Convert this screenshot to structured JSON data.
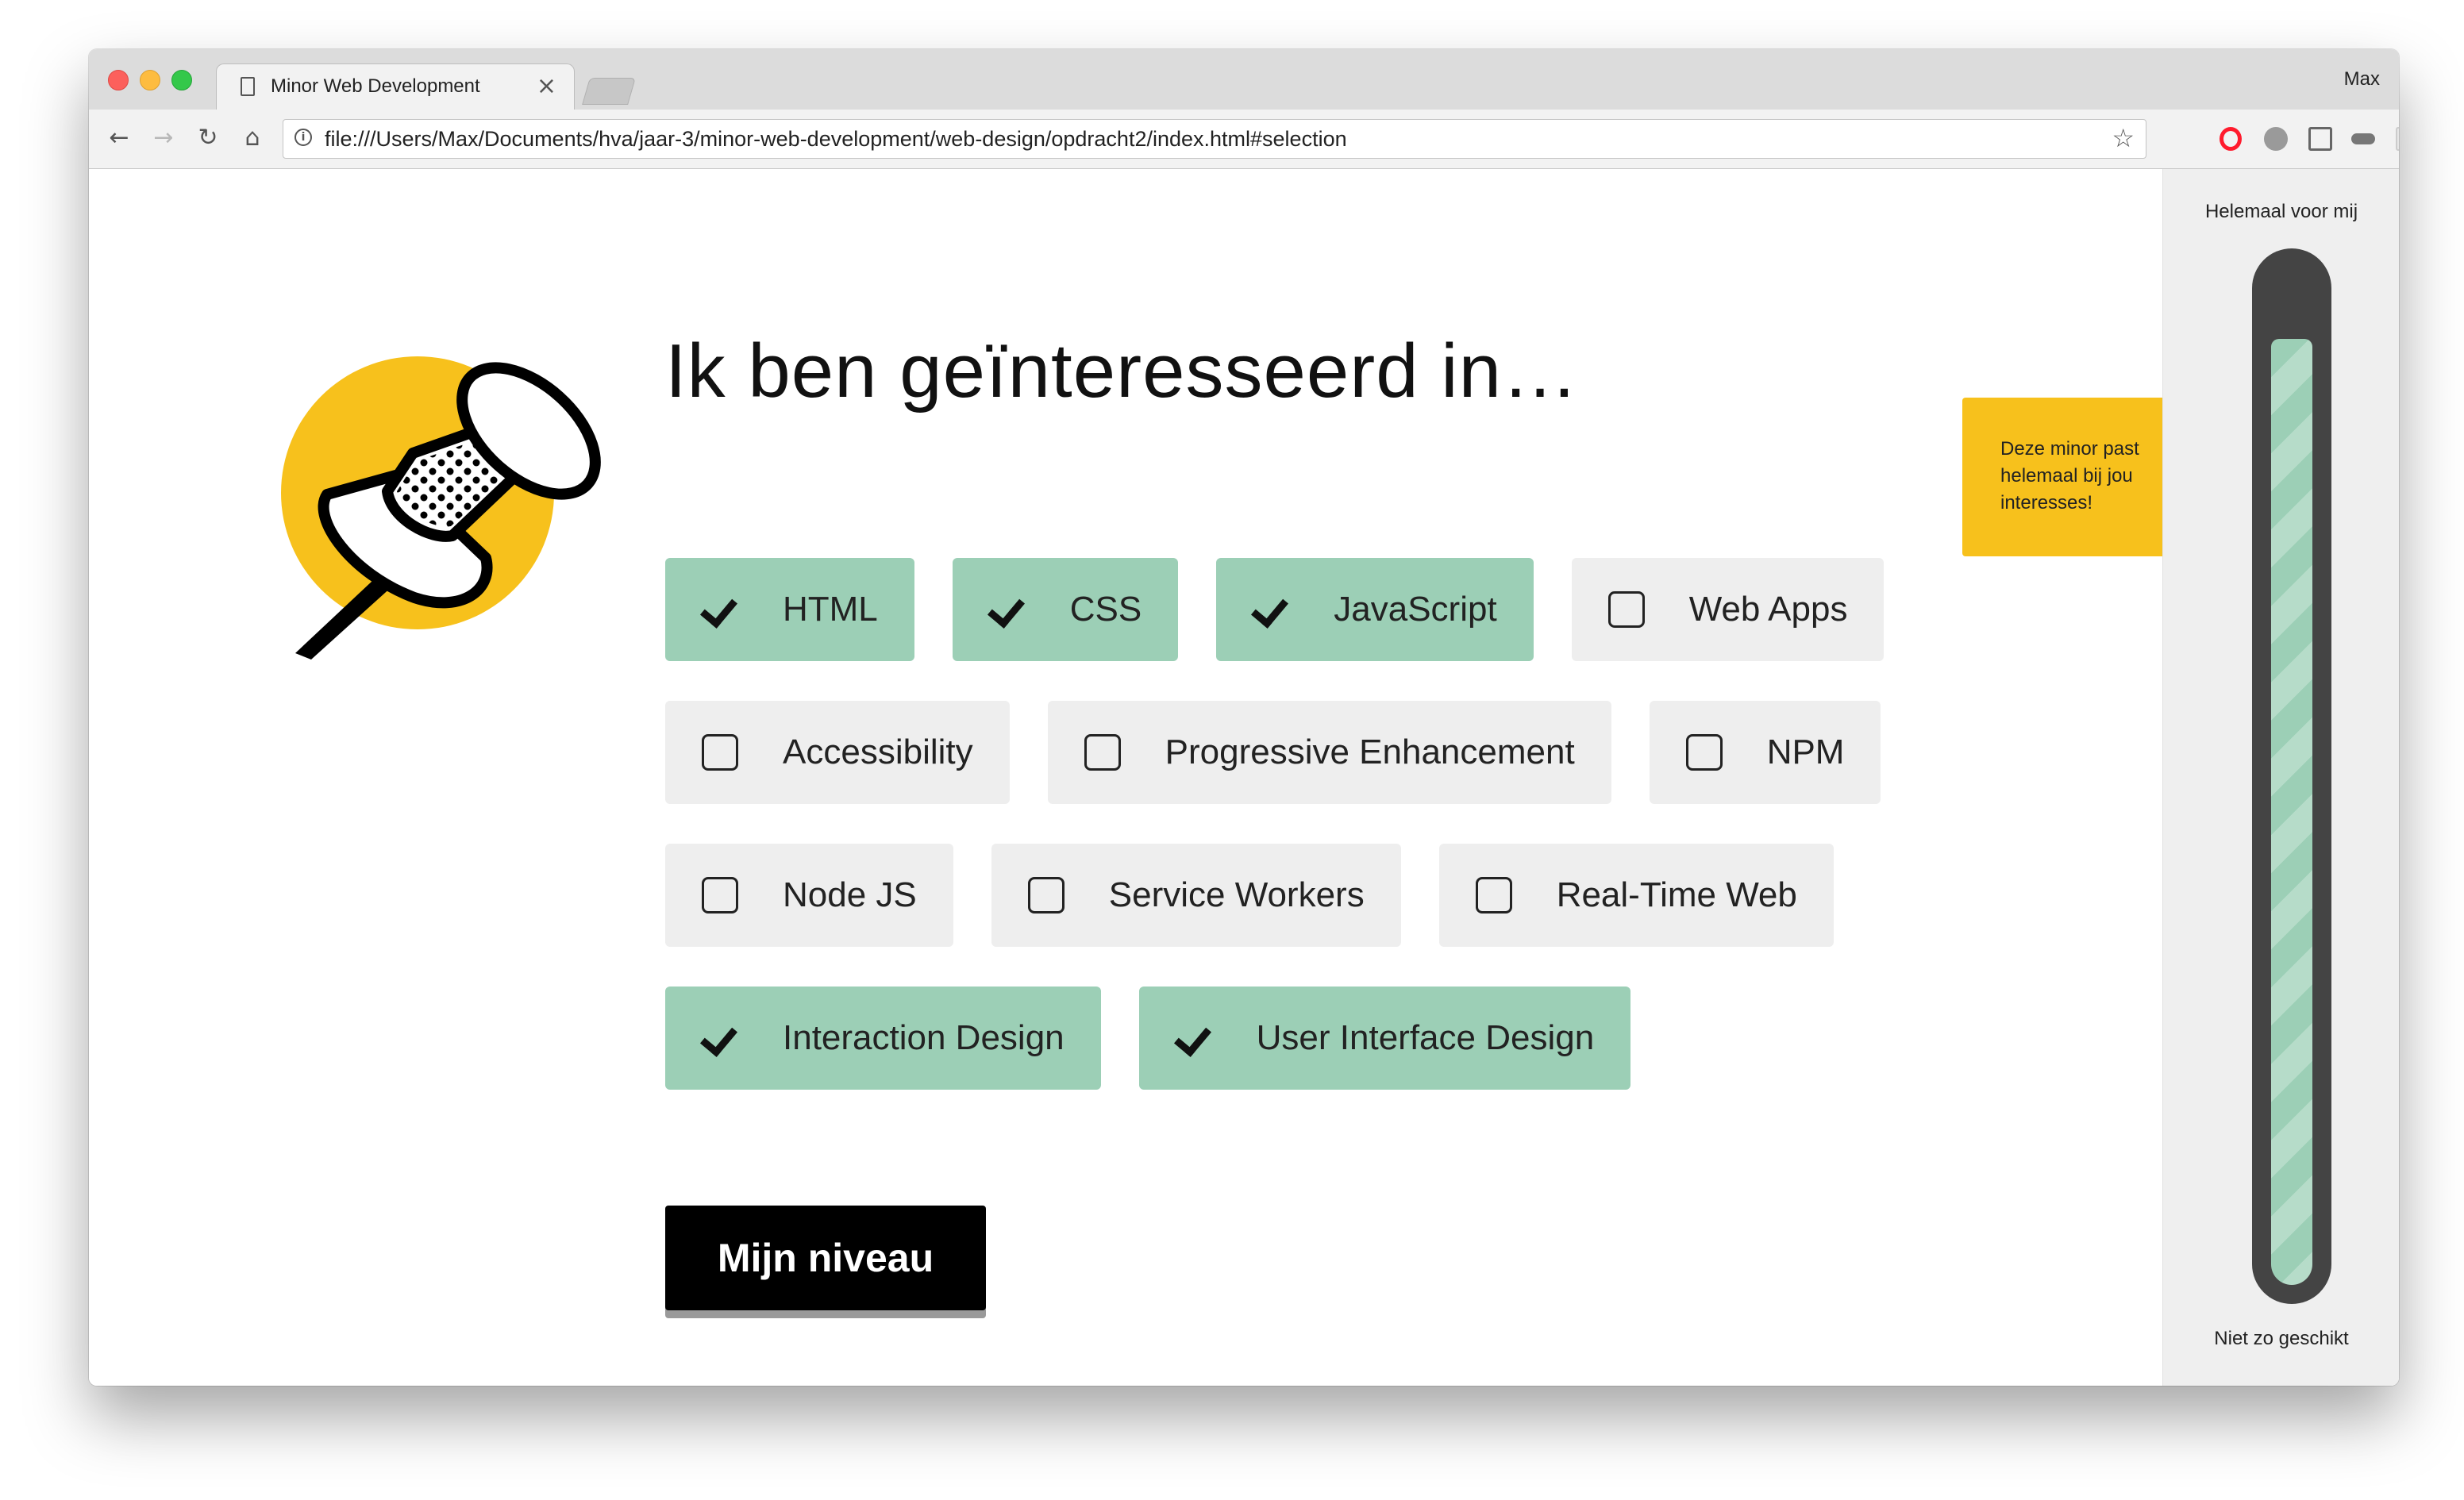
{
  "browser": {
    "tab_title": "Minor Web Development",
    "tab_close": "×",
    "profile_name": "Max",
    "url": "file:///Users/Max/Documents/hva/jaar-3/minor-web-development/web-design/opdracht2/index.html#selection",
    "icons": [
      "back-arrow-icon",
      "forward-arrow-icon",
      "reload-icon",
      "home-icon",
      "info-icon",
      "star-icon",
      "opera-icon",
      "gear-icon",
      "cast-icon",
      "glasses-icon",
      "grid-icon",
      "update-icon"
    ]
  },
  "page": {
    "heading": "Ik ben geïnteresseerd in…",
    "options": [
      [
        {
          "label": "HTML",
          "checked": true
        },
        {
          "label": "CSS",
          "checked": true
        },
        {
          "label": "JavaScript",
          "checked": true
        },
        {
          "label": "Web Apps",
          "checked": false
        }
      ],
      [
        {
          "label": "Accessibility",
          "checked": false
        },
        {
          "label": "Progressive Enhancement",
          "checked": false
        },
        {
          "label": "NPM",
          "checked": false
        }
      ],
      [
        {
          "label": "Node JS",
          "checked": false
        },
        {
          "label": "Service Workers",
          "checked": false
        },
        {
          "label": "Real-Time Web",
          "checked": false
        }
      ],
      [
        {
          "label": "Interaction Design",
          "checked": true
        },
        {
          "label": "User Interface Design",
          "checked": true
        }
      ]
    ],
    "button_label": "Mijn niveau"
  },
  "meter": {
    "top_label": "Helemaal voor mij",
    "bottom_label": "Niet zo geschikt",
    "level_percent": 93,
    "tooltip": "Deze minor past helemaal bij jou interesses!"
  },
  "colors": {
    "checked": "#9ccfb6",
    "unchecked": "#eeeeee",
    "accent_yellow": "#f7c11c",
    "meter_track": "#444444",
    "button": "#000000"
  }
}
